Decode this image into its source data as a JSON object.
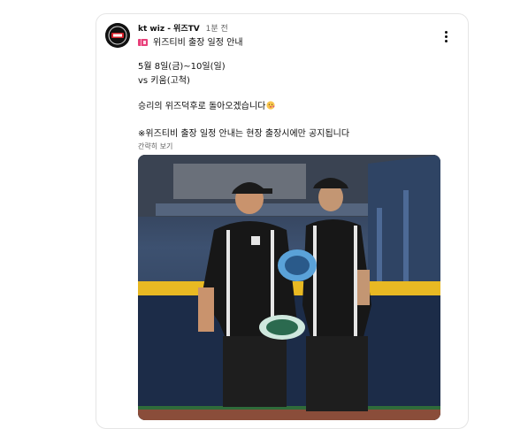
{
  "post": {
    "channel_name": "kt wiz - 위즈TV",
    "time_ago": "1분 전",
    "title": "위즈티비 출장 일정 안내",
    "date_line": "5월 8일(금)~10일(일)",
    "match_line": "vs 키움(고척)",
    "message": "승리의 위즈덕후로 돌아오겠습니다",
    "notice": "※위즈티비 출장 일정 안내는 현장 출장시에만 공지됩니다",
    "show_less": "간략히 보기",
    "title_emoji": "ticket-icon",
    "message_emoji": "face-icon",
    "menu_icon": "more-vert-icon"
  },
  "colors": {
    "text": "#0f0f0f",
    "secondary": "#606060",
    "border": "#e5e5e5"
  }
}
